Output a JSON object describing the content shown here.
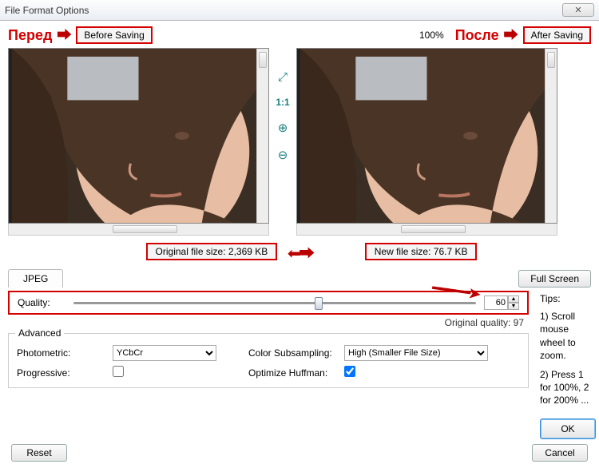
{
  "title": "File Format Options",
  "annotations": {
    "before_label": "Перед",
    "after_label": "После",
    "before_box": "Before Saving",
    "after_box": "After Saving"
  },
  "zoom_percent": "100%",
  "tools": {
    "fit": "⤢",
    "one_to_one": "1:1",
    "zoom_in": "⊕",
    "zoom_out": "⊖"
  },
  "filesize": {
    "original": "Original file size:  2,369 KB",
    "new": "New file size:  76.7 KB"
  },
  "tab_label": "JPEG",
  "fullscreen_btn": "Full Screen",
  "quality": {
    "label": "Quality:",
    "value": "60",
    "original": "Original quality: 97"
  },
  "advanced": {
    "legend": "Advanced",
    "photometric_label": "Photometric:",
    "photometric_value": "YCbCr",
    "subsampling_label": "Color Subsampling:",
    "subsampling_value": "High (Smaller File Size)",
    "progressive_label": "Progressive:",
    "huffman_label": "Optimize Huffman:"
  },
  "tips": {
    "heading": "Tips:",
    "t1": "1) Scroll mouse wheel to zoom.",
    "t2": "2) Press 1 for 100%, 2 for 200% ..."
  },
  "buttons": {
    "reset": "Reset",
    "ok": "OK",
    "cancel": "Cancel"
  }
}
